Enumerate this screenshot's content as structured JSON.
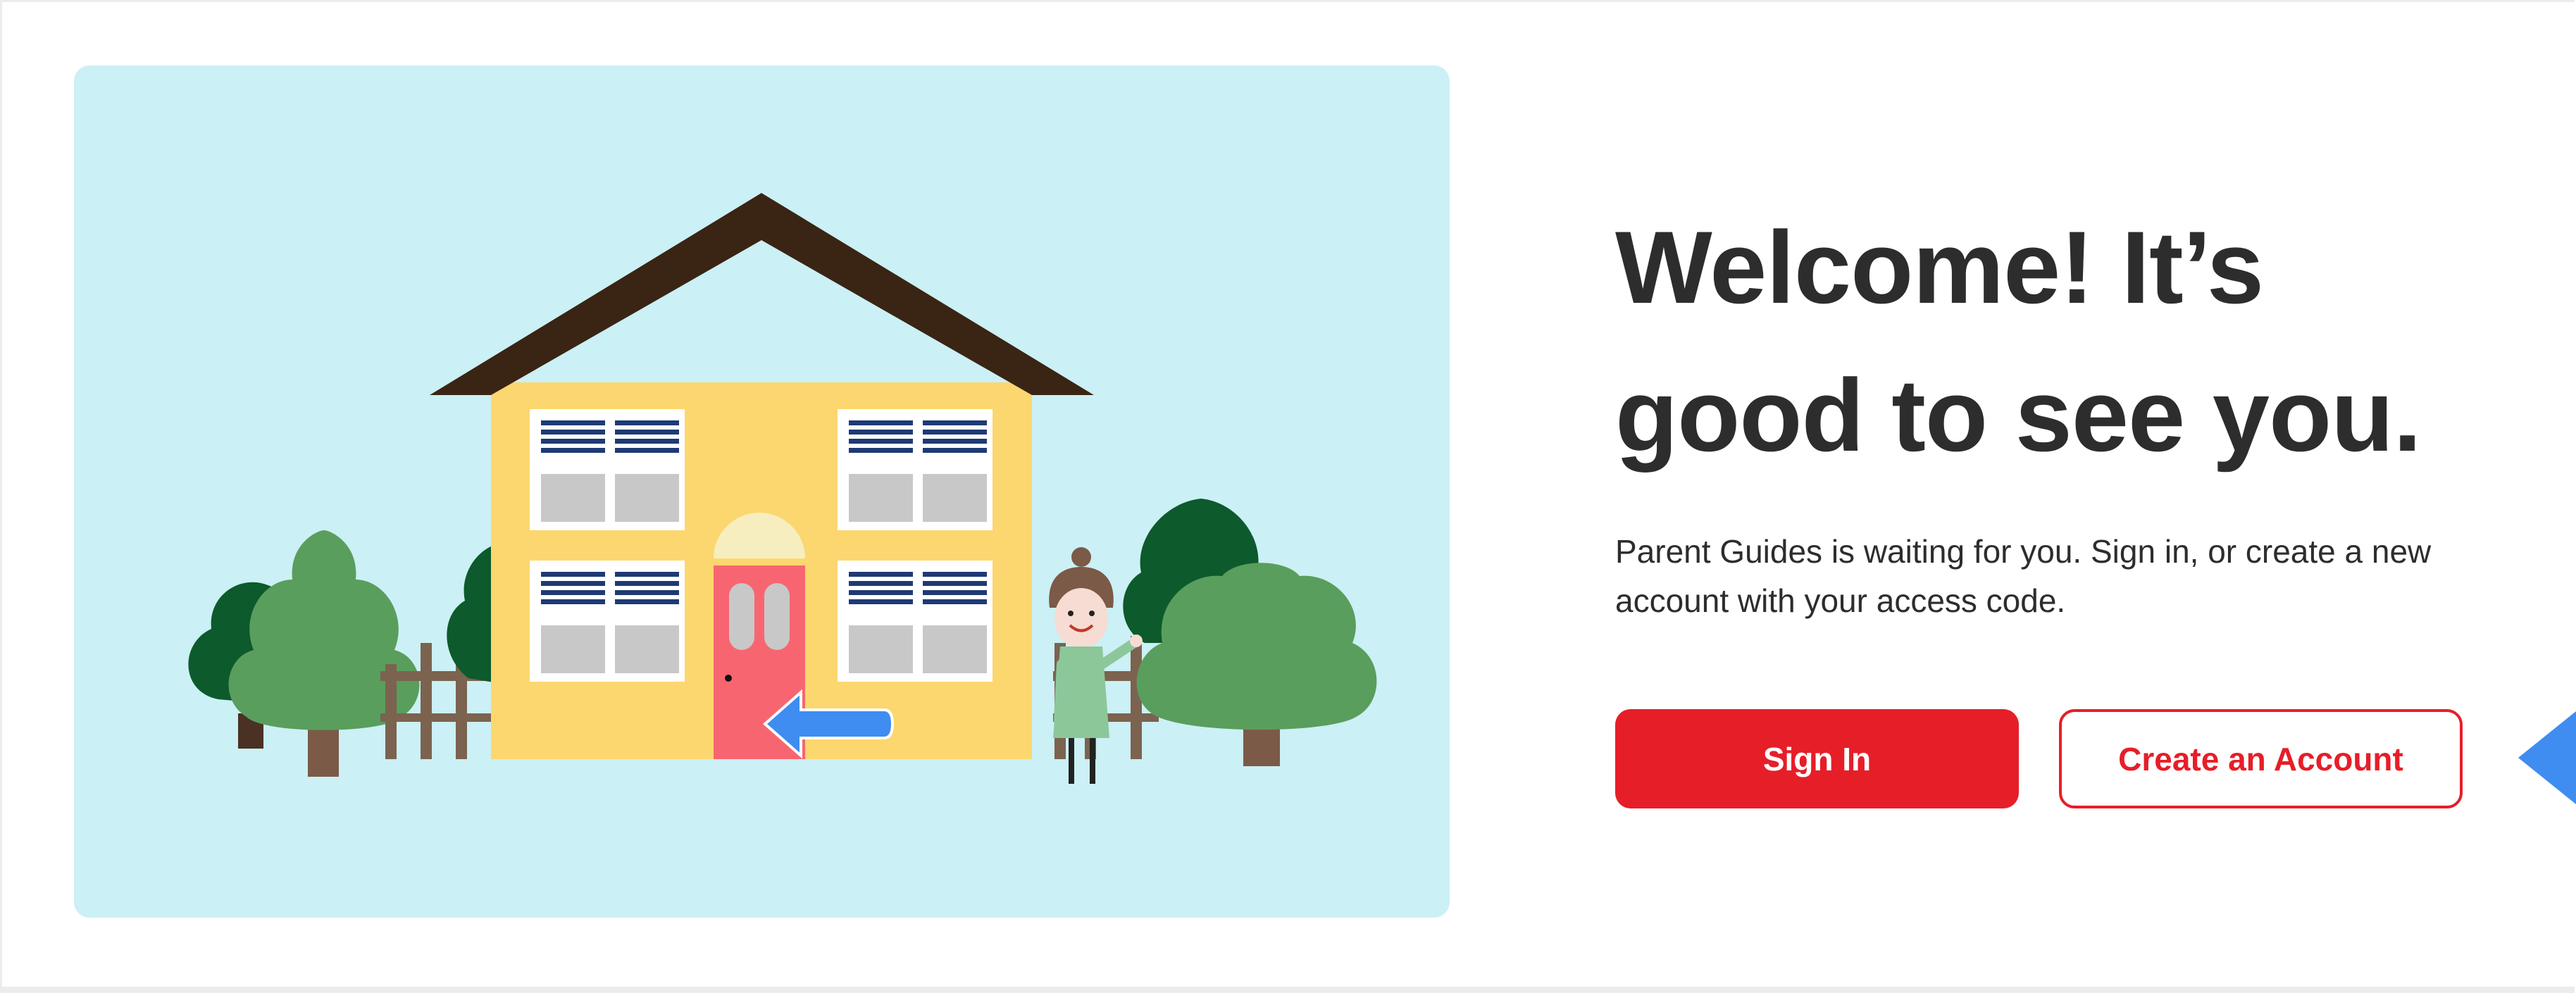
{
  "welcome": {
    "title_line1": "Welcome! It’s",
    "title_line2": "good to see you.",
    "description": "Parent Guides is waiting for you. Sign in, or create a new account with your access code."
  },
  "actions": {
    "sign_in_label": "Sign In",
    "create_account_label": "Create an Account"
  },
  "illustration": {
    "scene": "house-with-person-icon",
    "pointer": "arrow-left-icon"
  },
  "colors": {
    "brand_red": "#e61e28",
    "panel_bg": "#cbf0f5",
    "house_yellow": "#fcd76f",
    "roof_brown": "#3a2414",
    "door_coral": "#f76670",
    "pointer_blue": "#3f8df0",
    "text_dark": "#2d2d2d"
  }
}
